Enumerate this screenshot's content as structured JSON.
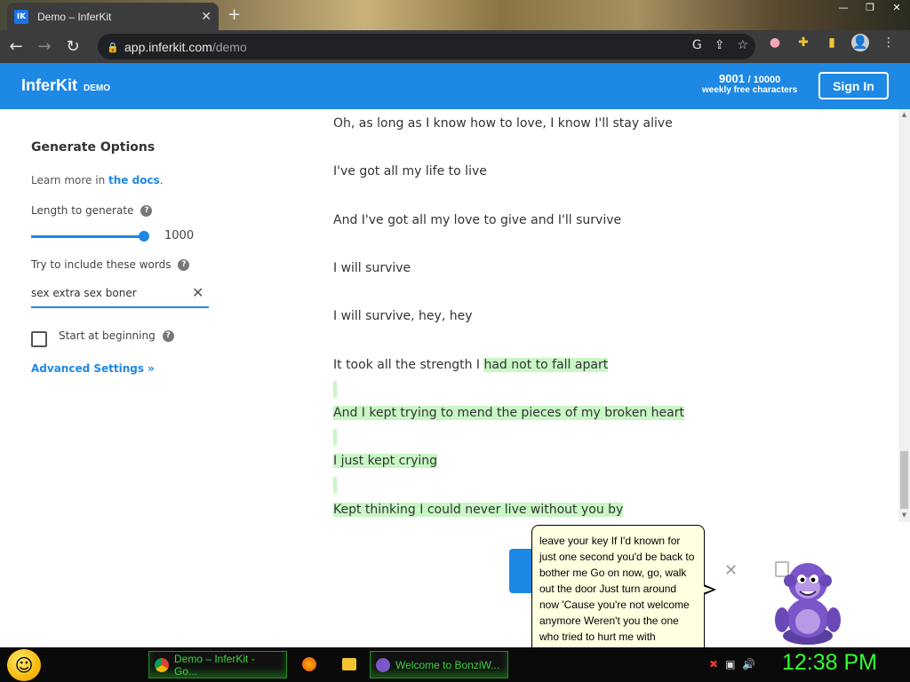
{
  "browser": {
    "tab_title": "Demo – InferKit",
    "tab_favicon": "IK",
    "url_host": "app.inferkit.com",
    "url_path": "/demo"
  },
  "header": {
    "brand": "InferKit",
    "brand_tag": "DEMO",
    "quota_used": "9001",
    "quota_max": "/ 10000",
    "quota_label": "weekly free characters",
    "signin_label": "Sign In"
  },
  "options": {
    "title": "Generate Options",
    "learn_prefix": "Learn more in ",
    "learn_link": "the docs",
    "learn_suffix": ".",
    "length_label": "Length to generate",
    "length_value": "1000",
    "words_label": "Try to include these words",
    "words_value": "sex extra sex boner",
    "start_label": "Start at beginning",
    "advanced_label": "Advanced Settings »"
  },
  "output": {
    "line1": "Oh, as long as I know how to love, I know I'll stay alive",
    "line2": "I've got all my life to live",
    "line3": "And I've got all my love to give and I'll survive",
    "line4": "I will survive",
    "line5": "I will survive, hey, hey",
    "line6_plain": "It took all the strength I ",
    "line6_hl": "had not to fall apart",
    "line7": "And I kept trying to mend the pieces of my broken heart",
    "line8": "I just kept crying",
    "line9": "Kept thinking I could never live without you by"
  },
  "balloon": {
    "text": "leave your key If I'd known for just one second you'd be back to bother me Go on now, go, walk out the door Just turn around now 'Cause you're not welcome anymore Weren't you the one who tried to hurt me with goodbye? You think I'd crumble? You think I'd lay down and die? Oh no, not I, I"
  },
  "taskbar": {
    "task1": "Demo – InferKit - Go...",
    "task2": "Welcome to BonziW...",
    "clock": "12:38 PM"
  },
  "colors": {
    "accent": "#1e88e5",
    "highlight": "#c8f7c5",
    "clock": "#33ff33"
  }
}
